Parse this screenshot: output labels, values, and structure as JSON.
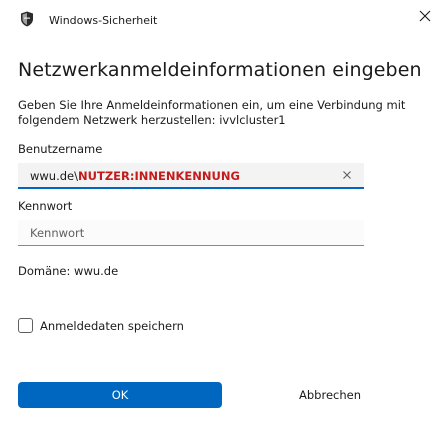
{
  "window": {
    "app_title": "Windows-Sicherheit",
    "close_glyph": "✕"
  },
  "heading": "Netzwerkanmeldeinformationen eingeben",
  "description": "Geben Sie Ihre Anmeldeinformationen ein, um eine Verbindung mit folgendem Netzwerk herzustellen: ivvlcluster1",
  "username": {
    "label": "Benutzername",
    "value_prefix": "wwu.de\\",
    "value_highlight": "NUTZER:INNENKENNUNG",
    "highlight_color": "#c41a1a"
  },
  "password": {
    "label": "Kennwort",
    "placeholder": "Kennwort"
  },
  "domain_text": "Domäne: wwu.de",
  "remember": {
    "label": "Anmeldedaten speichern",
    "checked": false
  },
  "buttons": {
    "ok": "OK",
    "cancel": "Abbrechen"
  },
  "colors": {
    "accent": "#0067c0"
  }
}
